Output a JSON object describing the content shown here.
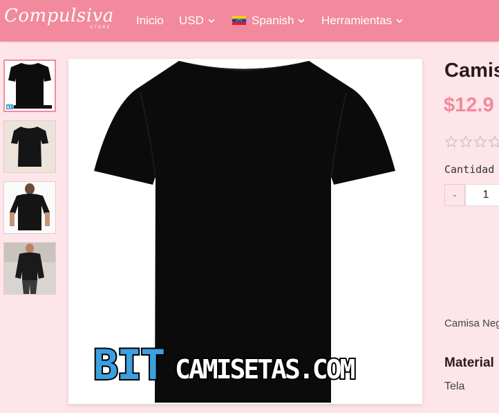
{
  "brand": {
    "logo_text": "Compulsiva",
    "logo_sub": "STORE"
  },
  "nav": {
    "inicio": "Inicio",
    "currency": "USD",
    "language": "Spanish",
    "tools": "Herramientas"
  },
  "colors": {
    "navbar": "#f2899c",
    "background": "#fde5ea",
    "price": "#f08a9b"
  },
  "gallery": {
    "thumbnails": [
      {
        "name": "tshirt-front-watermark",
        "active": true
      },
      {
        "name": "tshirt-side",
        "active": false
      },
      {
        "name": "model-back",
        "active": false
      },
      {
        "name": "model-shirt",
        "active": false
      }
    ],
    "watermark": {
      "part1": "BIT",
      "part2": "CAMISETAS.COM"
    }
  },
  "product": {
    "title": "Camis",
    "price": "$12.9",
    "rating": 0,
    "rating_max": 5,
    "quantity_label": "Cantidad",
    "quantity_minus": "-",
    "quantity_value": "1",
    "description": "Camisa Neg",
    "material_heading": "Material",
    "material_value": "Tela"
  }
}
